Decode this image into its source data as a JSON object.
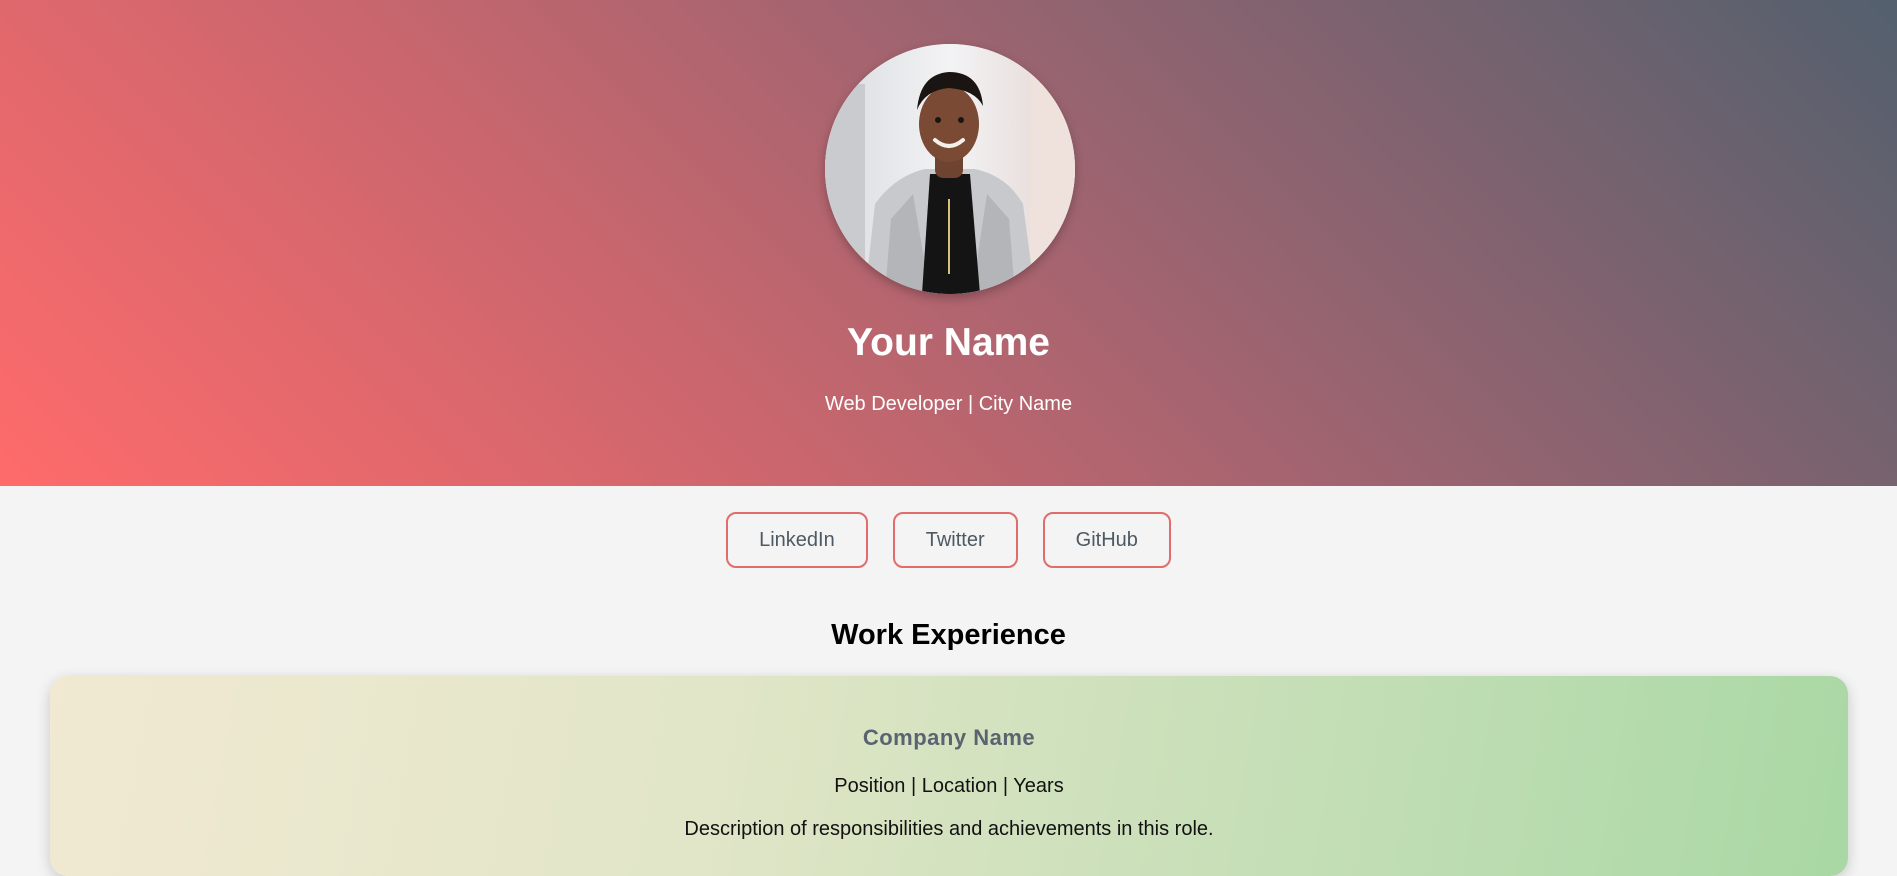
{
  "header": {
    "name": "Your Name",
    "subtitle": "Web Developer | City Name",
    "gradient_colors": [
      "#ff6b6b",
      "#53606e"
    ]
  },
  "social_links": [
    {
      "label": "LinkedIn",
      "icon": "linkedin"
    },
    {
      "label": "Twitter",
      "icon": "twitter"
    },
    {
      "label": "GitHub",
      "icon": "github"
    }
  ],
  "work_experience": {
    "title": "Work Experience",
    "entries": [
      {
        "company": "Company Name",
        "position": "Position | Location | Years",
        "description": "Description of responsibilities and achievements in this role."
      }
    ]
  },
  "colors": {
    "accent_border": "#e06c6c",
    "page_background": "#f4f4f4",
    "card_gradient": [
      "#f1e9d2",
      "#a9d8a4"
    ]
  }
}
